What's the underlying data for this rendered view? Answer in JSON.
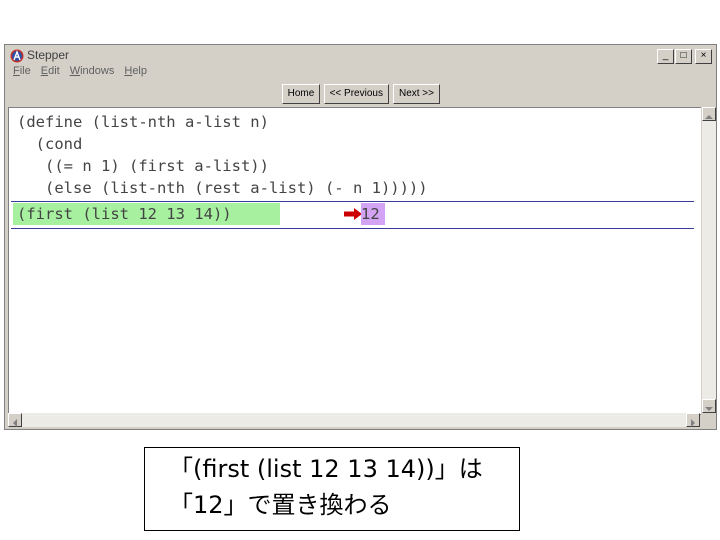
{
  "window": {
    "title": "Stepper",
    "controls": {
      "minimize": "_",
      "maximize": "□",
      "close": "×"
    }
  },
  "menu": [
    "File",
    "Edit",
    "Windows",
    "Help"
  ],
  "toolbar": {
    "home_label": "Home",
    "previous_label": "<< Previous",
    "next_label": "Next >>"
  },
  "code": "(define (list-nth a-list n)\n  (cond\n   ((= n 1) (first a-list))\n   (else (list-nth (rest a-list) (- n 1)))))",
  "step": {
    "before": "(first (list 12 13 14))",
    "after": "12",
    "before_color": "#a6f0a0",
    "after_color": "#d4a4f4",
    "arrow_color": "#cc0000"
  },
  "caption": {
    "line1": "「(first (list 12 13 14))」は",
    "line2": "「12」で置き換わる"
  }
}
